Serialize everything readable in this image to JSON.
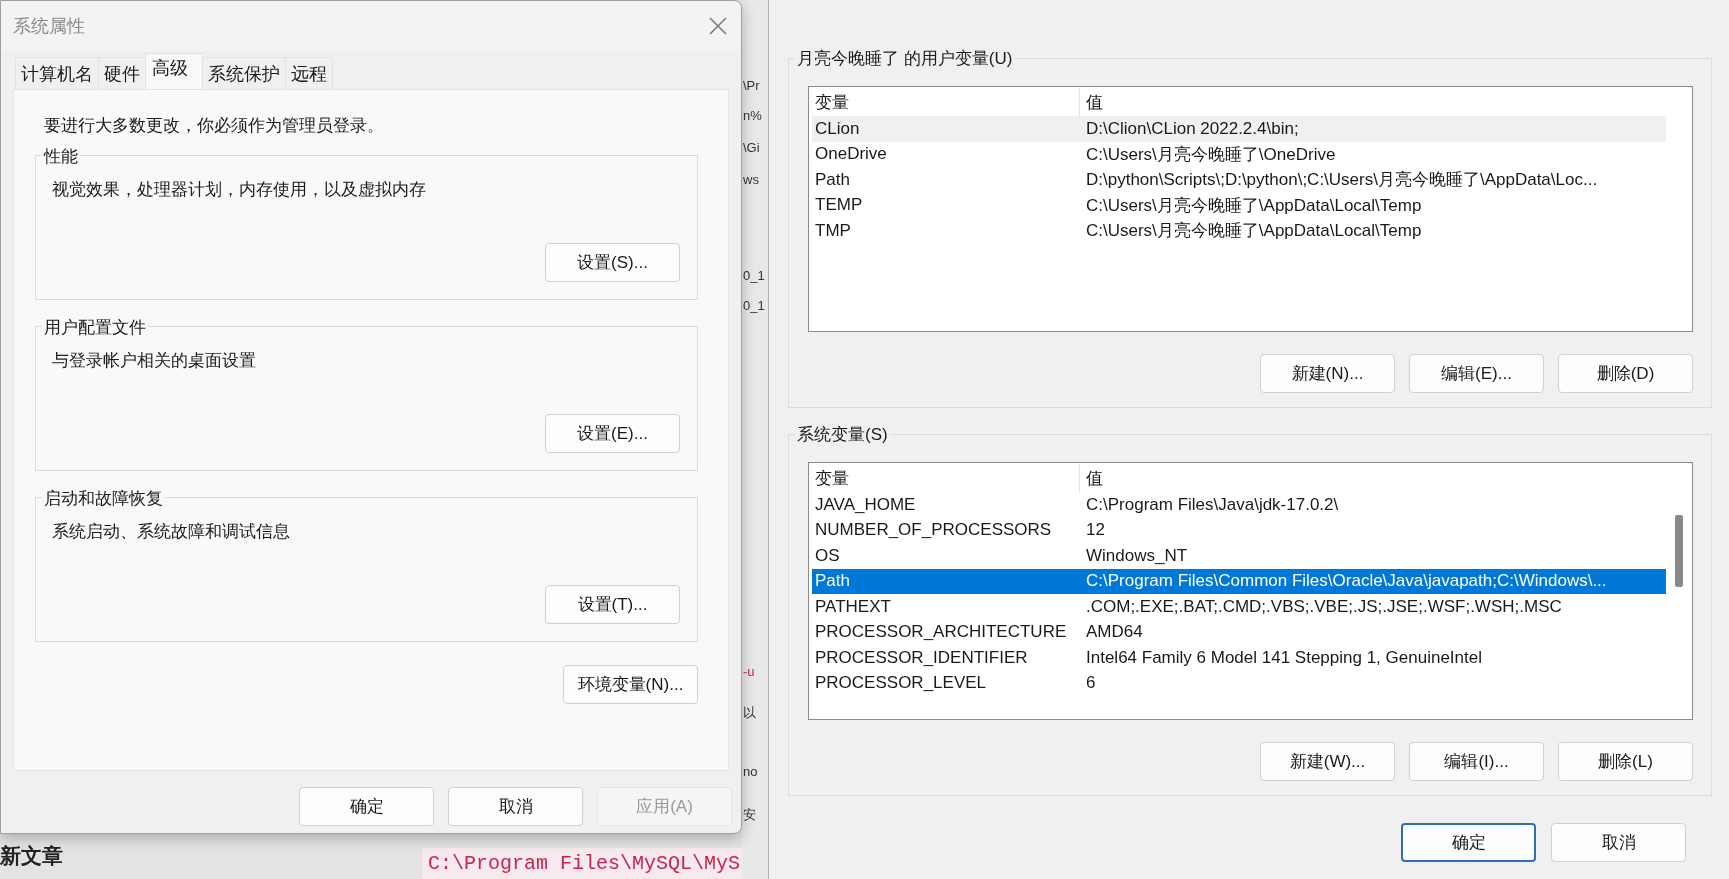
{
  "left_dialog": {
    "title": "系统属性",
    "tabs": [
      {
        "label": "计算机名",
        "selected": false
      },
      {
        "label": "硬件",
        "selected": false
      },
      {
        "label": "高级",
        "selected": true
      },
      {
        "label": "系统保护",
        "selected": false
      },
      {
        "label": "远程",
        "selected": false
      }
    ],
    "notice": "要进行大多数更改，你必须作为管理员登录。",
    "groups": [
      {
        "title": "性能",
        "description": "视觉效果，处理器计划，内存使用，以及虚拟内存",
        "button": "设置(S)..."
      },
      {
        "title": "用户配置文件",
        "description": "与登录帐户相关的桌面设置",
        "button": "设置(E)..."
      },
      {
        "title": "启动和故障恢复",
        "description": "系统启动、系统故障和调试信息",
        "button": "设置(T)..."
      }
    ],
    "env_button": "环境变量(N)...",
    "buttons": [
      {
        "label": "确定",
        "disabled": false
      },
      {
        "label": "取消",
        "disabled": false
      },
      {
        "label": "应用(A)",
        "disabled": true
      }
    ]
  },
  "background": {
    "fragments": [
      "\\Pr",
      "n%",
      "\\Gi",
      "ws",
      "0_1",
      "0_1",
      "-u",
      "以",
      "no",
      "安"
    ],
    "heading": "新文章",
    "code": "C:\\Program Files\\MySQL\\MyS"
  },
  "right_dialog": {
    "user_vars": {
      "title": "月亮今晚睡了 的用户变量(U)",
      "focused": false,
      "columns": [
        "变量",
        "值"
      ],
      "rows": [
        {
          "name": "CLion",
          "value": "D:\\Clion\\CLion 2022.2.4\\bin;",
          "selected": true
        },
        {
          "name": "OneDrive",
          "value": "C:\\Users\\月亮今晚睡了\\OneDrive",
          "selected": false
        },
        {
          "name": "Path",
          "value": "D:\\python\\Scripts\\;D:\\python\\;C:\\Users\\月亮今晚睡了\\AppData\\Loc...",
          "selected": false
        },
        {
          "name": "TEMP",
          "value": "C:\\Users\\月亮今晚睡了\\AppData\\Local\\Temp",
          "selected": false
        },
        {
          "name": "TMP",
          "value": "C:\\Users\\月亮今晚睡了\\AppData\\Local\\Temp",
          "selected": false
        }
      ],
      "buttons": [
        "新建(N)...",
        "编辑(E)...",
        "删除(D)"
      ]
    },
    "system_vars": {
      "title": "系统变量(S)",
      "focused": true,
      "columns": [
        "变量",
        "值"
      ],
      "rows": [
        {
          "name": "JAVA_HOME",
          "value": "C:\\Program Files\\Java\\jdk-17.0.2\\",
          "selected": false
        },
        {
          "name": "NUMBER_OF_PROCESSORS",
          "value": "12",
          "selected": false
        },
        {
          "name": "OS",
          "value": "Windows_NT",
          "selected": false
        },
        {
          "name": "Path",
          "value": "C:\\Program Files\\Common Files\\Oracle\\Java\\javapath;C:\\Windows\\...",
          "selected": true
        },
        {
          "name": "PATHEXT",
          "value": ".COM;.EXE;.BAT;.CMD;.VBS;.VBE;.JS;.JSE;.WSF;.WSH;.MSC",
          "selected": false
        },
        {
          "name": "PROCESSOR_ARCHITECTURE",
          "value": "AMD64",
          "selected": false
        },
        {
          "name": "PROCESSOR_IDENTIFIER",
          "value": "Intel64 Family 6 Model 141 Stepping 1, GenuineIntel",
          "selected": false
        },
        {
          "name": "PROCESSOR_LEVEL",
          "value": "6",
          "selected": false
        }
      ],
      "buttons": [
        "新建(W)...",
        "编辑(I)...",
        "删除(L)"
      ]
    },
    "buttons": [
      {
        "label": "确定",
        "default": true
      },
      {
        "label": "取消",
        "default": false
      }
    ]
  }
}
